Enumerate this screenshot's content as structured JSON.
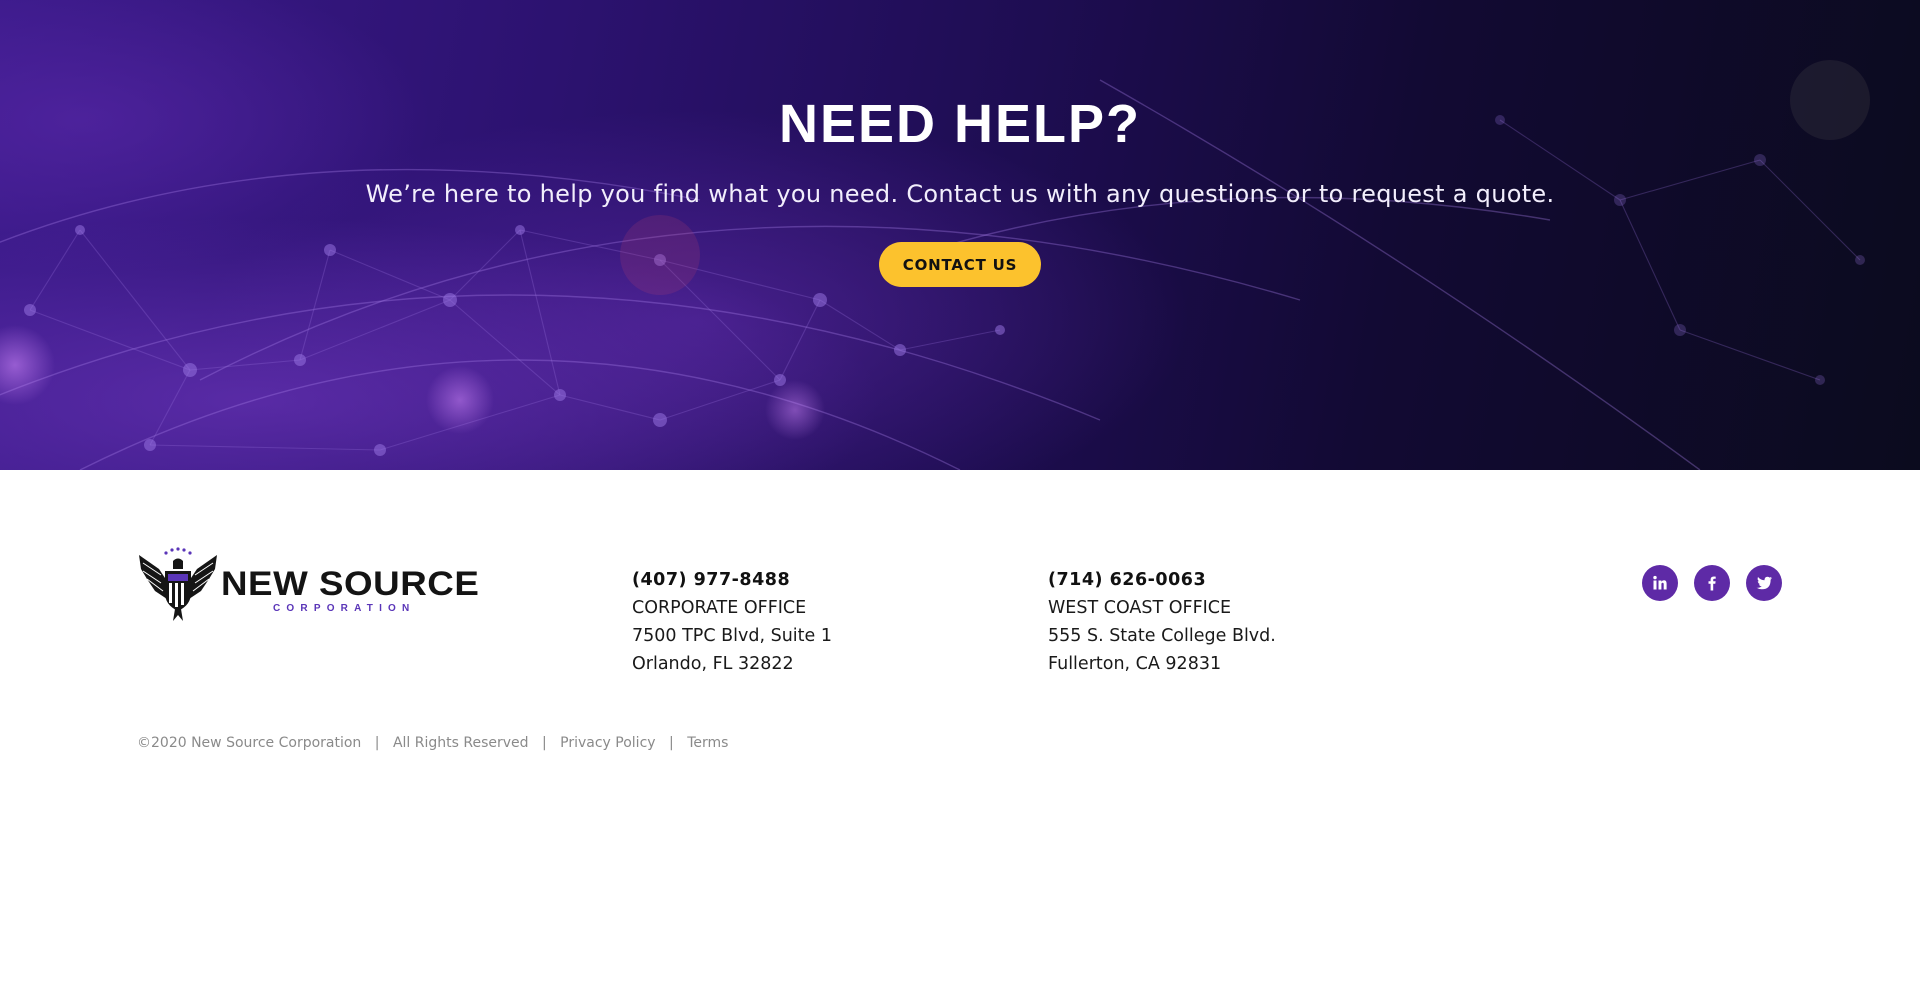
{
  "hero": {
    "title": "NEED HELP?",
    "subtitle": "We’re here to help you find what you need. Contact us with any questions or to request a quote.",
    "contact_button_label": "CONTACT US"
  },
  "logo": {
    "name": "NEW SOURCE",
    "subtitle": "CORPORATION",
    "alt": "New Source Corporation logo"
  },
  "offices": [
    {
      "phone": "(407) 977-8488",
      "name": "CORPORATE OFFICE",
      "address_line1": "7500 TPC Blvd, Suite 1",
      "address_line2": "Orlando, FL 32822"
    },
    {
      "phone": "(714) 626-0063",
      "name": "WEST COAST OFFICE",
      "address_line1": "555 S. State College Blvd.",
      "address_line2": "Fullerton, CA 92831"
    }
  ],
  "social": [
    {
      "name": "linkedin",
      "icon": "linkedin-icon"
    },
    {
      "name": "facebook",
      "icon": "facebook-icon"
    },
    {
      "name": "twitter",
      "icon": "twitter-icon"
    }
  ],
  "legal": {
    "copyright": "©2020 New Source Corporation",
    "rights": "All Rights Reserved",
    "separator": "|",
    "privacy_link": "Privacy Policy",
    "terms_link": "Terms"
  },
  "colors": {
    "accent_button": "#fcc22d",
    "social_purple": "#5e2aa6",
    "hero_dark": "#1e0d52",
    "logo_sub": "#5a35b8"
  }
}
